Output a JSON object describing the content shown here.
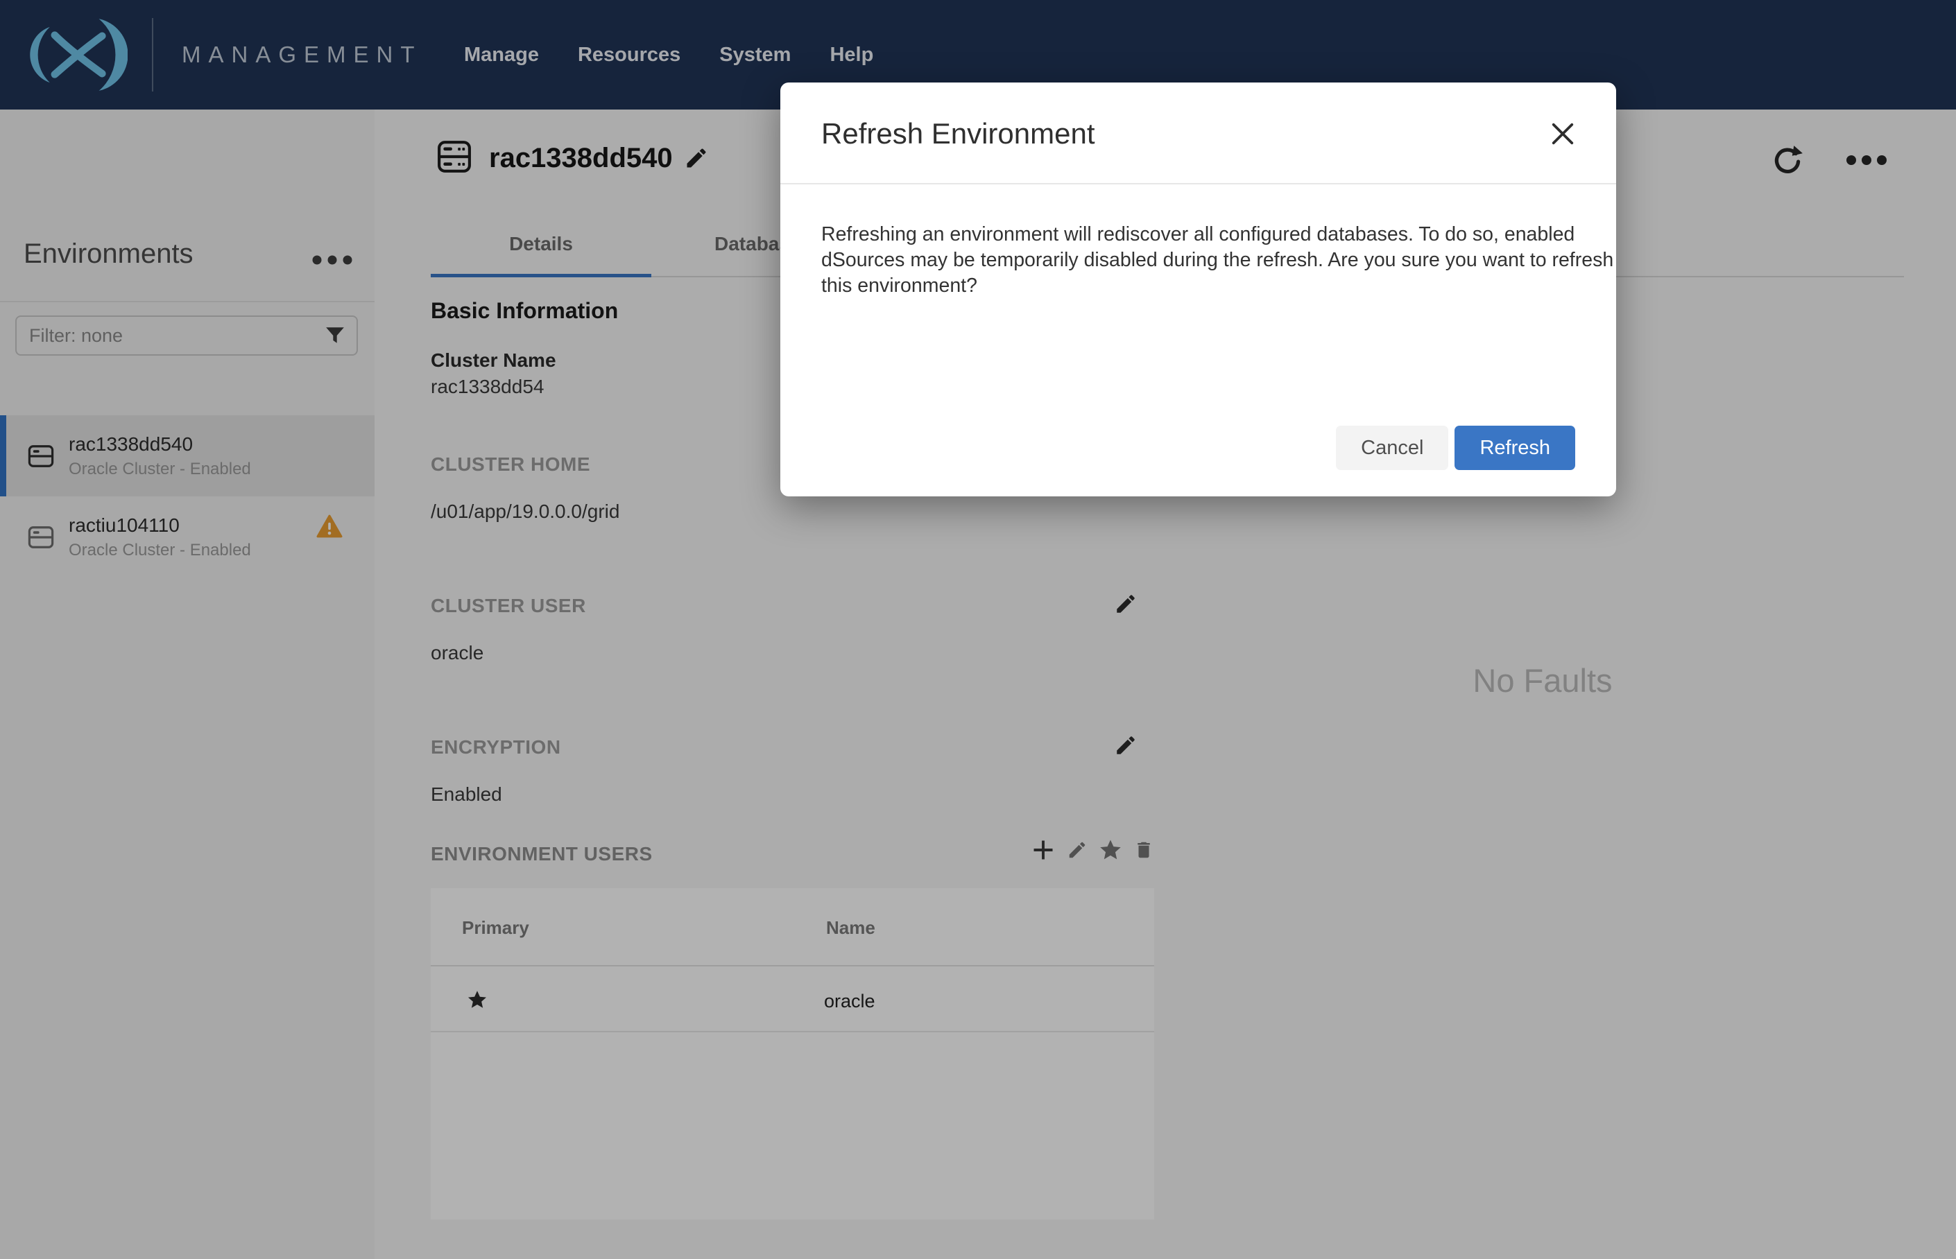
{
  "nav": {
    "brand": "MANAGEMENT",
    "items": [
      {
        "label": "Manage"
      },
      {
        "label": "Resources"
      },
      {
        "label": "System"
      },
      {
        "label": "Help"
      }
    ]
  },
  "sidebar": {
    "title": "Environments",
    "filter_placeholder": "Filter: none",
    "items": [
      {
        "name": "rac1338dd540",
        "subtitle": "Oracle Cluster - Enabled",
        "selected": true,
        "warning": false
      },
      {
        "name": "ractiu104110",
        "subtitle": "Oracle Cluster - Enabled",
        "selected": false,
        "warning": true
      }
    ]
  },
  "main": {
    "title": "rac1338dd540",
    "tabs": [
      {
        "label": "Details",
        "active": true
      },
      {
        "label": "Databases",
        "active": false
      }
    ],
    "details": {
      "heading": "Basic Information",
      "cluster_name_label": "Cluster Name",
      "cluster_name_value": "rac1338dd54",
      "cluster_home_label": "CLUSTER HOME",
      "cluster_home_value": "/u01/app/19.0.0.0/grid",
      "cluster_user_label": "CLUSTER USER",
      "cluster_user_value": "oracle",
      "encryption_label": "ENCRYPTION",
      "encryption_value": "Enabled",
      "env_users_label": "ENVIRONMENT USERS"
    },
    "env_users_table": {
      "columns": [
        "Primary",
        "Name"
      ],
      "rows": [
        {
          "primary": true,
          "name": "oracle"
        }
      ]
    },
    "faults_empty": "No Faults"
  },
  "modal": {
    "title": "Refresh Environment",
    "body": "Refreshing an environment will rediscover all configured databases. To do so, enabled dSources may be temporarily disabled during the refresh. Are you sure you want to refresh this environment?",
    "cancel_label": "Cancel",
    "confirm_label": "Refresh"
  },
  "colors": {
    "nav_bg": "#203456",
    "logo_teal": "#71c4ea",
    "accent_blue": "#3a76c5",
    "warning_amber": "#e89c31",
    "selected_item_bg": "#e3e3e3"
  }
}
